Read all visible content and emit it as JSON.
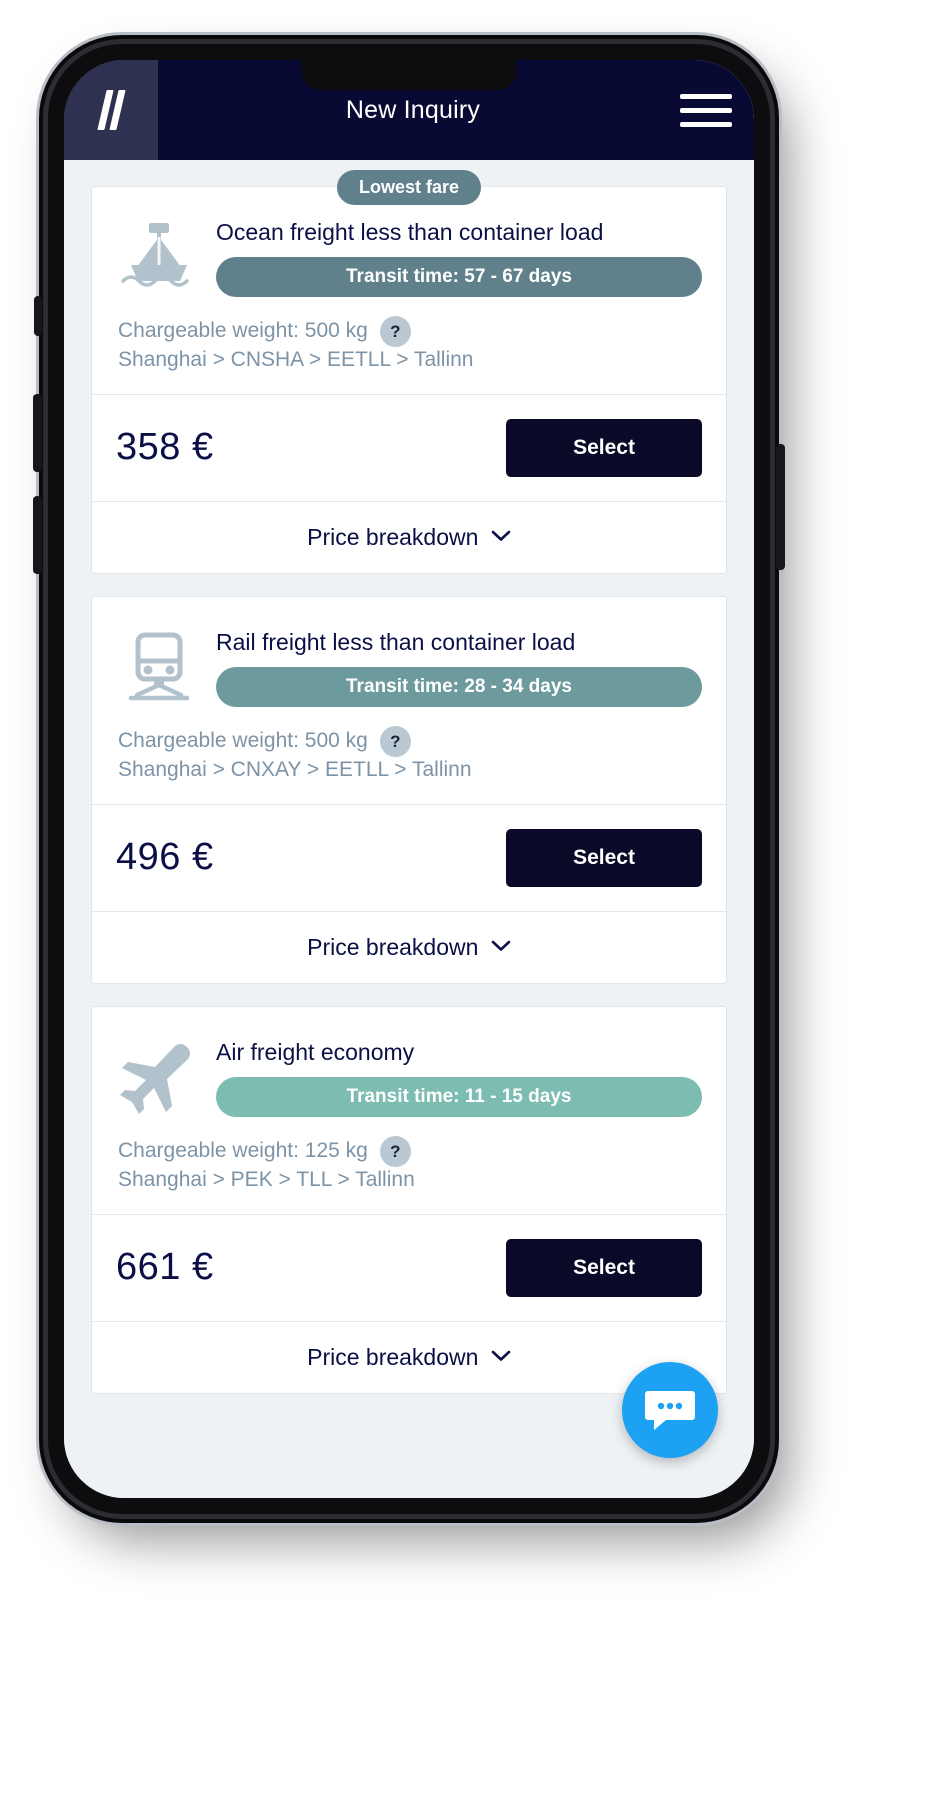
{
  "header": {
    "title": "New Inquiry",
    "logo_name": "double-slash-logo",
    "menu_name": "hamburger-menu"
  },
  "labels": {
    "select": "Select",
    "price_breakdown": "Price breakdown",
    "help": "?",
    "chevron": "⌄"
  },
  "colors": {
    "header_bg": "#080a33",
    "logo_bg": "#2e3150",
    "page_bg": "#eef2f5",
    "card_bg": "#ffffff",
    "title_navy": "#0a1045",
    "muted_text": "#7d93a6",
    "select_btn": "#0a0a28",
    "ribbon": "#60808c",
    "chat_blue": "#1da1f2",
    "icon_gray": "#b2c2cc"
  },
  "offers": [
    {
      "ribbon": "Lowest fare",
      "icon": "ship-icon",
      "title": "Ocean freight less than container load",
      "transit": "Transit time: 57 - 67 days",
      "transit_color": "#60808c",
      "weight": "Chargeable weight: 500 kg",
      "route": "Shanghai > CNSHA > EETLL > Tallinn",
      "price": "358 €"
    },
    {
      "ribbon": "",
      "icon": "train-icon",
      "title": "Rail freight less than container load",
      "transit": "Transit time: 28 - 34 days",
      "transit_color": "#6d9a9c",
      "weight": "Chargeable weight: 500 kg",
      "route": "Shanghai > CNXAY > EETLL > Tallinn",
      "price": "496 €"
    },
    {
      "ribbon": "",
      "icon": "airplane-icon",
      "title": "Air freight economy",
      "transit": "Transit time: 11 - 15 days",
      "transit_color": "#7dbcb0",
      "weight": "Chargeable weight: 125 kg",
      "route": "Shanghai > PEK > TLL > Tallinn",
      "price": "661 €"
    }
  ],
  "chat": {
    "name": "chat-bubble-icon"
  }
}
